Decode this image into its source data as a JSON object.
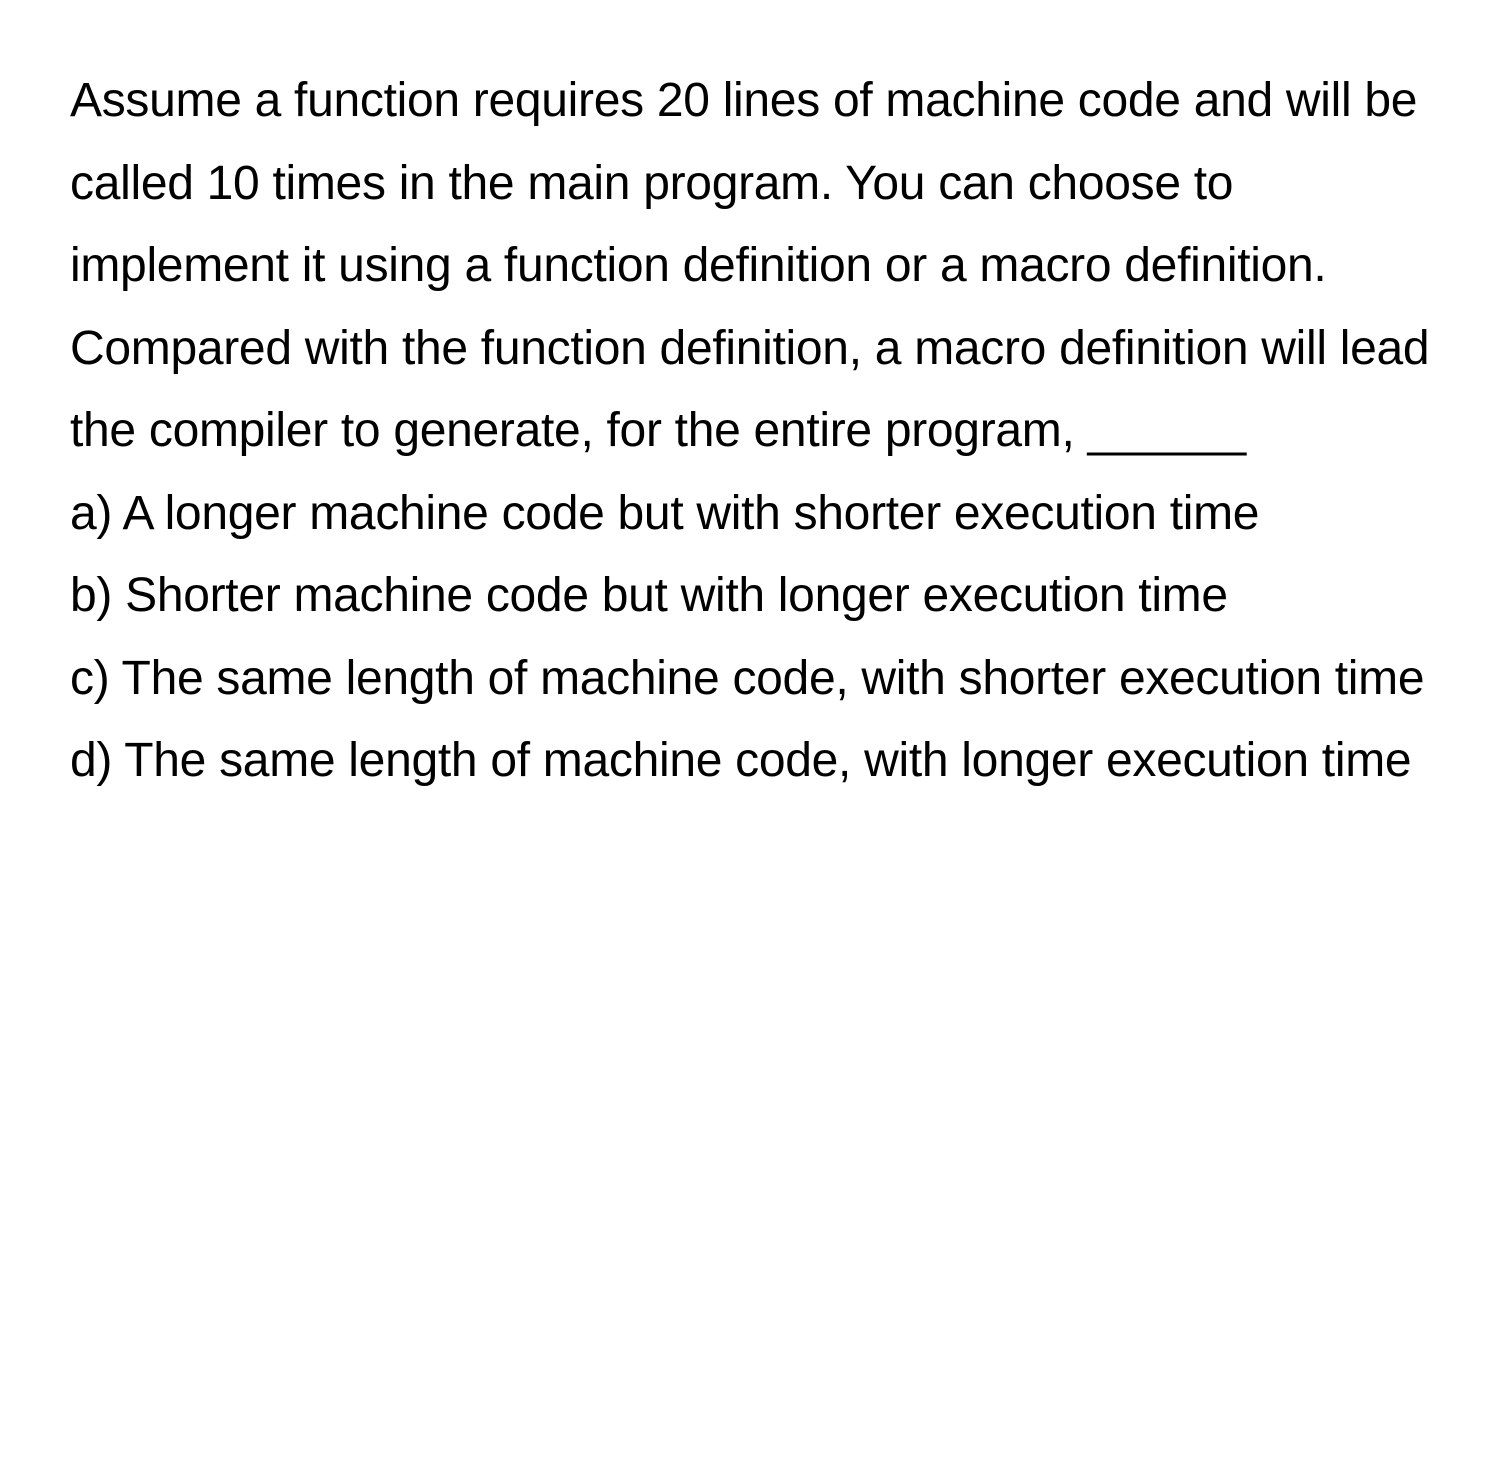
{
  "question": "Assume a function requires 20 lines of machine code and will be called 10 times in the main program. You can choose to implement it using a function definition or a macro definition. Compared with the function definition, a macro definition will lead the compiler to generate, for the entire program, ______",
  "options": {
    "a": "a) A longer machine code but with shorter execution time",
    "b": "b) Shorter machine code but with longer execution time",
    "c": "c) The same length of machine code, with shorter execution time",
    "d": "d) The same length of machine code, with longer execution time"
  }
}
